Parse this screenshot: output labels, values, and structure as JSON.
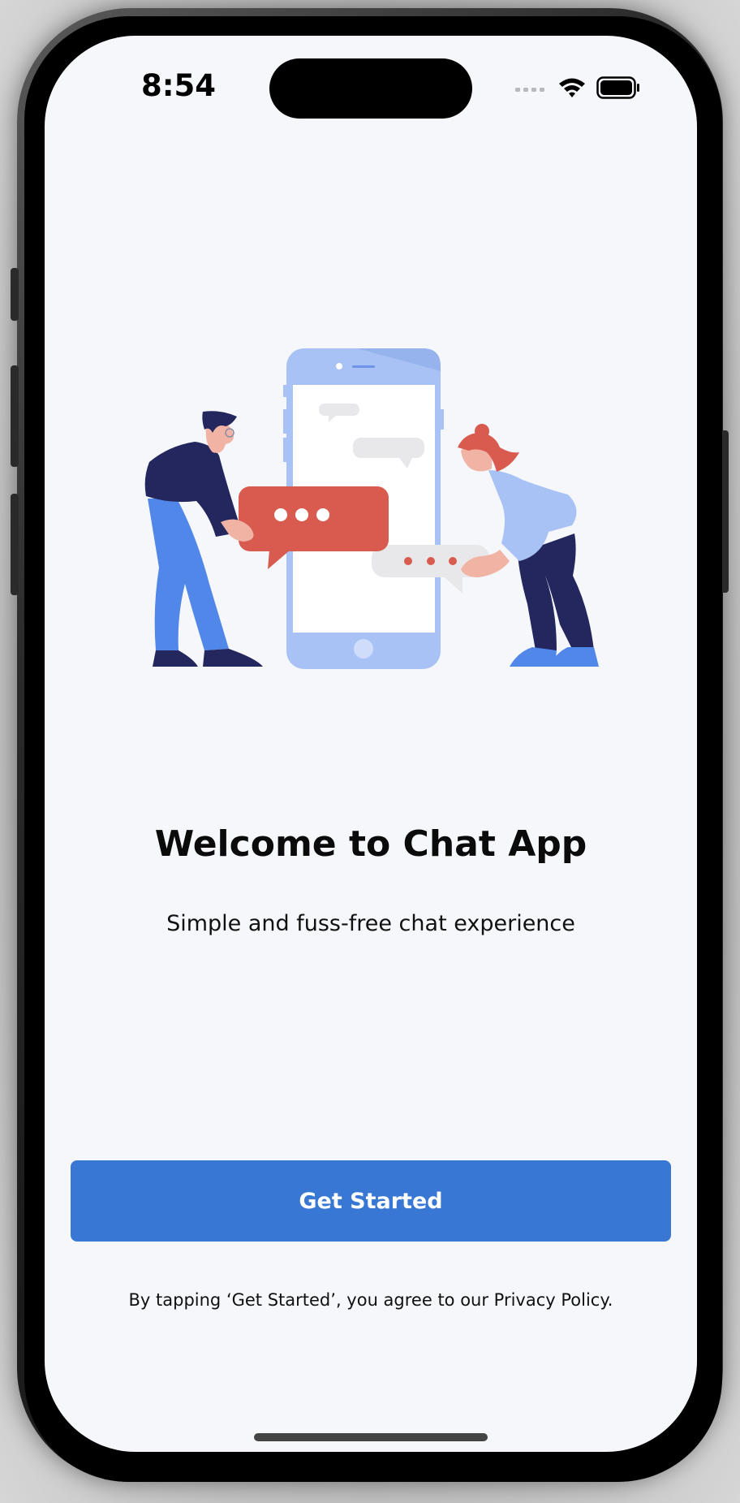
{
  "status_bar": {
    "time": "8:54"
  },
  "welcome": {
    "title": "Welcome to Chat App",
    "subtitle": "Simple and fuss-free chat experience"
  },
  "actions": {
    "get_started_label": "Get Started"
  },
  "legal": {
    "consent_text": "By tapping ‘Get Started’, you agree to our Privacy Policy."
  },
  "colors": {
    "background": "#f5f7fa",
    "primary_button": "#3878d4",
    "accent_red": "#d95a4e",
    "illustration_blue": "#a9c2f5",
    "illustration_navy": "#23275e"
  },
  "icons": [
    "signal-icon",
    "wifi-icon",
    "battery-icon"
  ]
}
